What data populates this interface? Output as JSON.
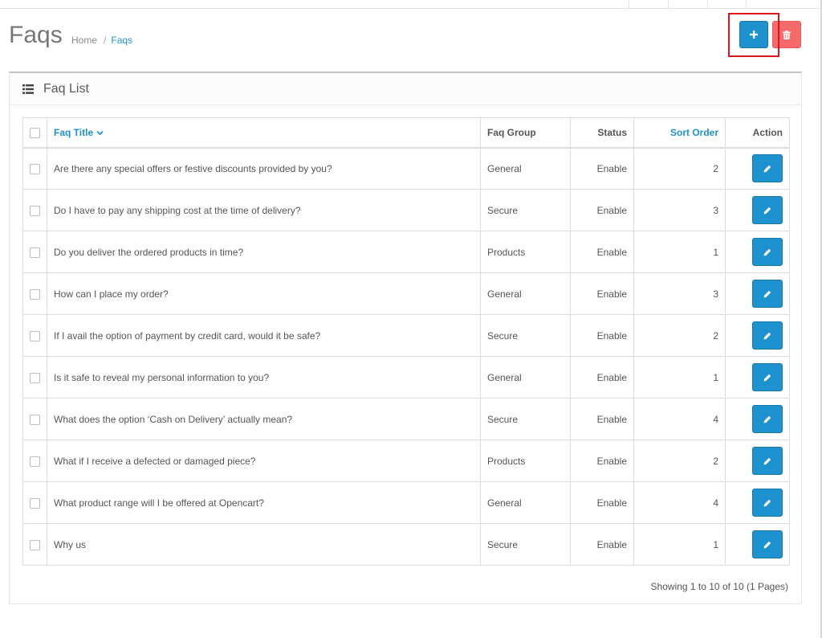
{
  "header": {
    "title": "Faqs",
    "breadcrumb": {
      "home": "Home",
      "separator": "/",
      "current": "Faqs"
    },
    "add_icon": "plus-icon",
    "delete_icon": "trash-icon"
  },
  "panel": {
    "title": "Faq List",
    "icon": "list-icon"
  },
  "table": {
    "columns": {
      "title": "Faq Title",
      "group": "Faq Group",
      "status": "Status",
      "sort_order": "Sort Order",
      "action": "Action"
    },
    "rows": [
      {
        "title": "Are there any special offers or festive discounts provided by you?",
        "group": "General",
        "status": "Enable",
        "sort_order": "2"
      },
      {
        "title": "Do I have to pay any shipping cost at the time of delivery?",
        "group": "Secure",
        "status": "Enable",
        "sort_order": "3"
      },
      {
        "title": "Do you deliver the ordered products in time?",
        "group": "Products",
        "status": "Enable",
        "sort_order": "1"
      },
      {
        "title": "How can I place my order?",
        "group": "General",
        "status": "Enable",
        "sort_order": "3"
      },
      {
        "title": "If I avail the option of payment by credit card, would it be safe?",
        "group": "Secure",
        "status": "Enable",
        "sort_order": "2"
      },
      {
        "title": "Is it safe to reveal my personal information to you?",
        "group": "General",
        "status": "Enable",
        "sort_order": "1"
      },
      {
        "title": "What does the option ‘Cash on Delivery’ actually mean?",
        "group": "Secure",
        "status": "Enable",
        "sort_order": "4"
      },
      {
        "title": "What if I receive a defected or damaged piece?",
        "group": "Products",
        "status": "Enable",
        "sort_order": "2"
      },
      {
        "title": "What product range will I be offered at Opencart?",
        "group": "General",
        "status": "Enable",
        "sort_order": "4"
      },
      {
        "title": "Why us",
        "group": "Secure",
        "status": "Enable",
        "sort_order": "1"
      }
    ]
  },
  "pagination": {
    "text": "Showing 1 to 10 of 10 (1 Pages)"
  },
  "colors": {
    "primary": "#1e91cf",
    "danger": "#f56b6b",
    "highlight": "#e0141e"
  }
}
